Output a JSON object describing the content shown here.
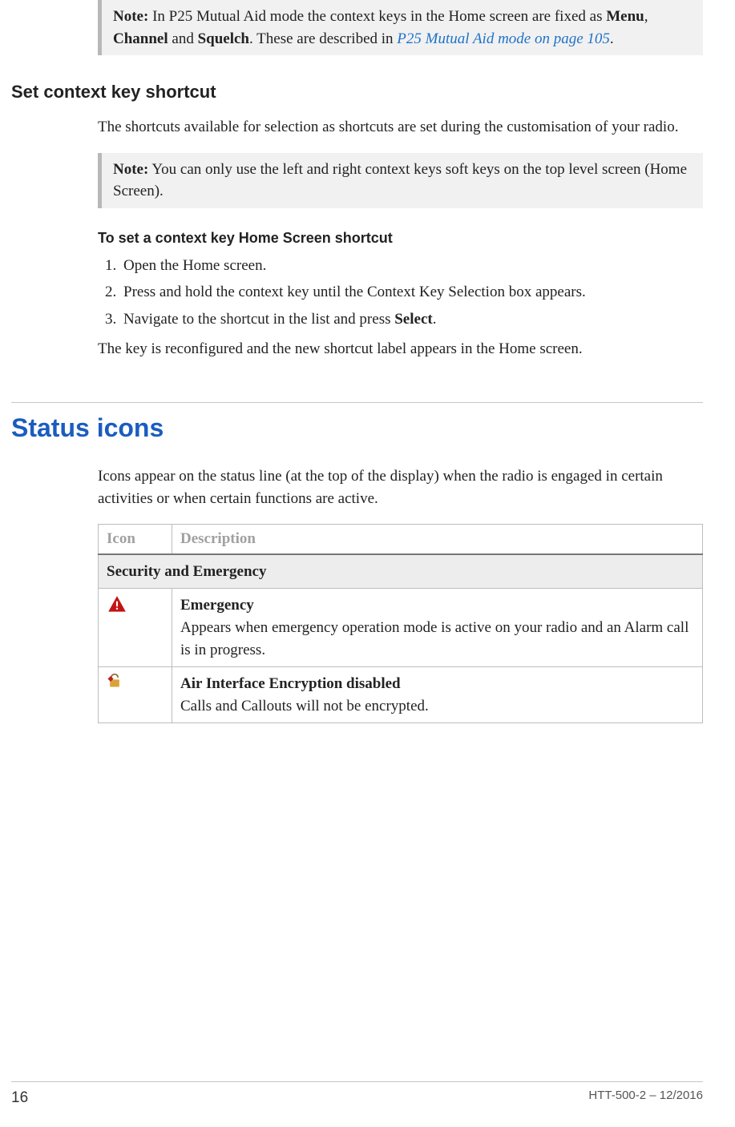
{
  "note1": {
    "label": "Note:",
    "pre": "  In P25 Mutual Aid mode the context keys in the Home screen are fixed as ",
    "b1": "Menu",
    "sep1": ", ",
    "b2": "Channel",
    "mid": " and ",
    "b3": "Squelch",
    "post": ". These are described in ",
    "xref": "P25 Mutual Aid mode",
    "xref2": " on page 105",
    "end": "."
  },
  "h_set": "Set context key shortcut",
  "p_shortcuts": "The shortcuts available for selection as shortcuts are set during the customisation of your radio.",
  "note2": {
    "label": "Note:",
    "text": "  You can only use the left and right context keys soft keys on the top level screen (Home Screen)."
  },
  "h_proc": "To set a context key Home Screen shortcut",
  "steps": {
    "s1": "Open the Home screen.",
    "s2": "Press and hold the context key until the Context Key Selection box appears.",
    "s3_pre": "Navigate to the shortcut in the list and press ",
    "s3_b": "Select",
    "s3_post": "."
  },
  "p_result": "The key is reconfigured and the new shortcut label appears in the Home screen.",
  "h_status": "Status icons",
  "p_status": "Icons appear on the status line (at the top of the display) when the radio is engaged in certain activities or when certain functions are active.",
  "table": {
    "h_icon": "Icon",
    "h_desc": "Description",
    "group": "Security and Emergency",
    "r1_title": "Emergency",
    "r1_text": "Appears when emergency operation mode is active on your radio and an Alarm call is in progress.",
    "r2_title": "Air Interface Encryption disabled",
    "r2_text": "Calls and Callouts will not be encrypted."
  },
  "footer": {
    "page": "16",
    "doc": "HTT-500-2 – 12/2016"
  }
}
